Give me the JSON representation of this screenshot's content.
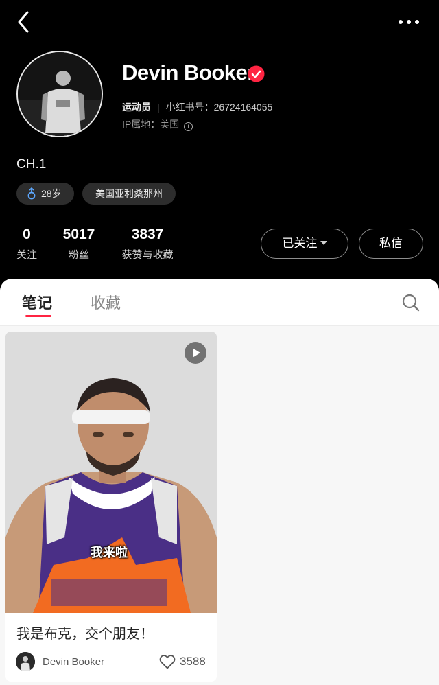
{
  "icons": {
    "back": "chevron-left-icon",
    "more": "more-dots-icon",
    "verified": "verified-check-icon",
    "info": "info-icon",
    "gender": "male-gender-icon",
    "search": "search-icon",
    "play": "play-icon",
    "like": "heart-icon"
  },
  "colors": {
    "accent": "#ff2442",
    "background": "#000000",
    "panel": "#f7f7f7"
  },
  "profile": {
    "name": "Devin Booker",
    "role": "运动员",
    "id_label": "小红书号：26724164055",
    "ip_label": "IP属地：美国",
    "info_glyph": "i",
    "bio": "CH.1",
    "tags": {
      "age": "28岁",
      "location": "美国亚利桑那州"
    }
  },
  "stats": [
    {
      "num": "0",
      "label": "关注"
    },
    {
      "num": "5017",
      "label": "粉丝"
    },
    {
      "num": "3837",
      "label": "获赞与收藏"
    }
  ],
  "actions": {
    "followed": "已关注",
    "message": "私信"
  },
  "tabs": {
    "notes": "笔记",
    "collections": "收藏"
  },
  "note": {
    "caption": "我来啦",
    "title": "我是布克，交个朋友！",
    "author": "Devin Booker",
    "likes": "3588"
  }
}
